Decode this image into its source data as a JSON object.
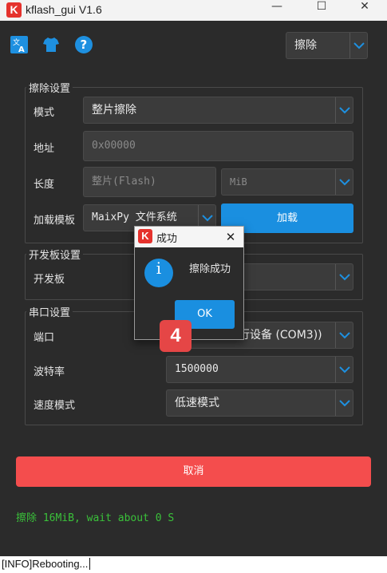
{
  "window": {
    "title": "kflash_gui V1.6",
    "logo_letter": "K"
  },
  "toolbar": {
    "action_combo": "擦除",
    "icons": [
      "translate-icon",
      "shirt-icon",
      "help-icon"
    ],
    "accent": "#1e90e0"
  },
  "erase_settings": {
    "title": "擦除设置",
    "mode_label": "模式",
    "mode_value": "整片擦除",
    "address_label": "地址",
    "address_placeholder": "0x00000",
    "length_label": "长度",
    "length_placeholder": "整片(Flash)",
    "length_unit": "MiB",
    "template_label": "加载模板",
    "template_value": "MaixPy 文件系统",
    "load_button": "加载"
  },
  "board_settings": {
    "title": "开发板设置",
    "board_label": "开发板"
  },
  "serial_settings": {
    "title": "串口设置",
    "port_label": "端口",
    "port_value": "行设备 (COM3))",
    "baud_label": "波特率",
    "baud_value": "1500000",
    "speed_label": "速度模式",
    "speed_value": "低速模式"
  },
  "cancel_button": "取消",
  "status_text": "擦除 16MiB, wait about 0 S",
  "log_text": "[INFO]Rebooting...",
  "dialog": {
    "title": "成功",
    "message": "擦除成功",
    "ok_button": "OK",
    "icon_letter": "i"
  },
  "step_badge": "4",
  "colors": {
    "danger": "#f44d4d",
    "primary": "#1a8fe0",
    "status": "#3ac13a",
    "badge": "#e54646"
  }
}
